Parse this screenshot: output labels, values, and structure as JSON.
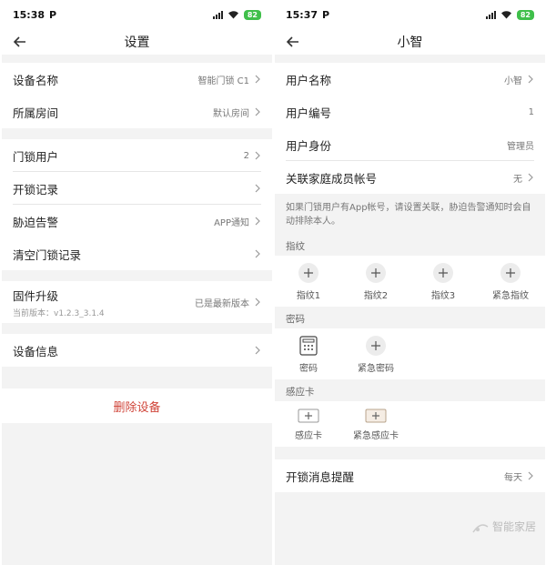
{
  "left": {
    "status": {
      "time": "15:38",
      "p": "P",
      "battery": "82"
    },
    "title": "设置",
    "rows": [
      {
        "label": "设备名称",
        "value": "智能门锁 C1"
      },
      {
        "label": "所属房间",
        "value": "默认房间"
      },
      {
        "label": "门锁用户",
        "value": "2"
      },
      {
        "label": "开锁记录",
        "value": ""
      },
      {
        "label": "胁迫告警",
        "value": "APP通知"
      },
      {
        "label": "清空门锁记录",
        "value": ""
      }
    ],
    "firmware": {
      "label": "固件升级",
      "sub": "当前版本：v1.2.3_3.1.4",
      "value": "已是最新版本"
    },
    "device_info": {
      "label": "设备信息"
    },
    "delete_label": "删除设备"
  },
  "right": {
    "status": {
      "time": "15:37",
      "p": "P",
      "battery": "82"
    },
    "title": "小智",
    "rows": [
      {
        "label": "用户名称",
        "value": "小智"
      },
      {
        "label": "用户编号",
        "value": "1"
      },
      {
        "label": "用户身份",
        "value": "管理员"
      },
      {
        "label": "关联家庭成员帐号",
        "value": "无"
      }
    ],
    "note": "如果门锁用户有App帐号，请设置关联，胁迫告警通知时会自动排除本人。",
    "fingerprint": {
      "header": "指纹",
      "items": [
        "指纹1",
        "指纹2",
        "指纹3",
        "紧急指纹"
      ]
    },
    "password": {
      "header": "密码",
      "items": [
        "密码",
        "紧急密码"
      ]
    },
    "card": {
      "header": "感应卡",
      "items": [
        "感应卡",
        "紧急感应卡"
      ]
    },
    "reminder": {
      "label": "开锁消息提醒",
      "value": "每天"
    }
  },
  "watermark": "智能家居"
}
